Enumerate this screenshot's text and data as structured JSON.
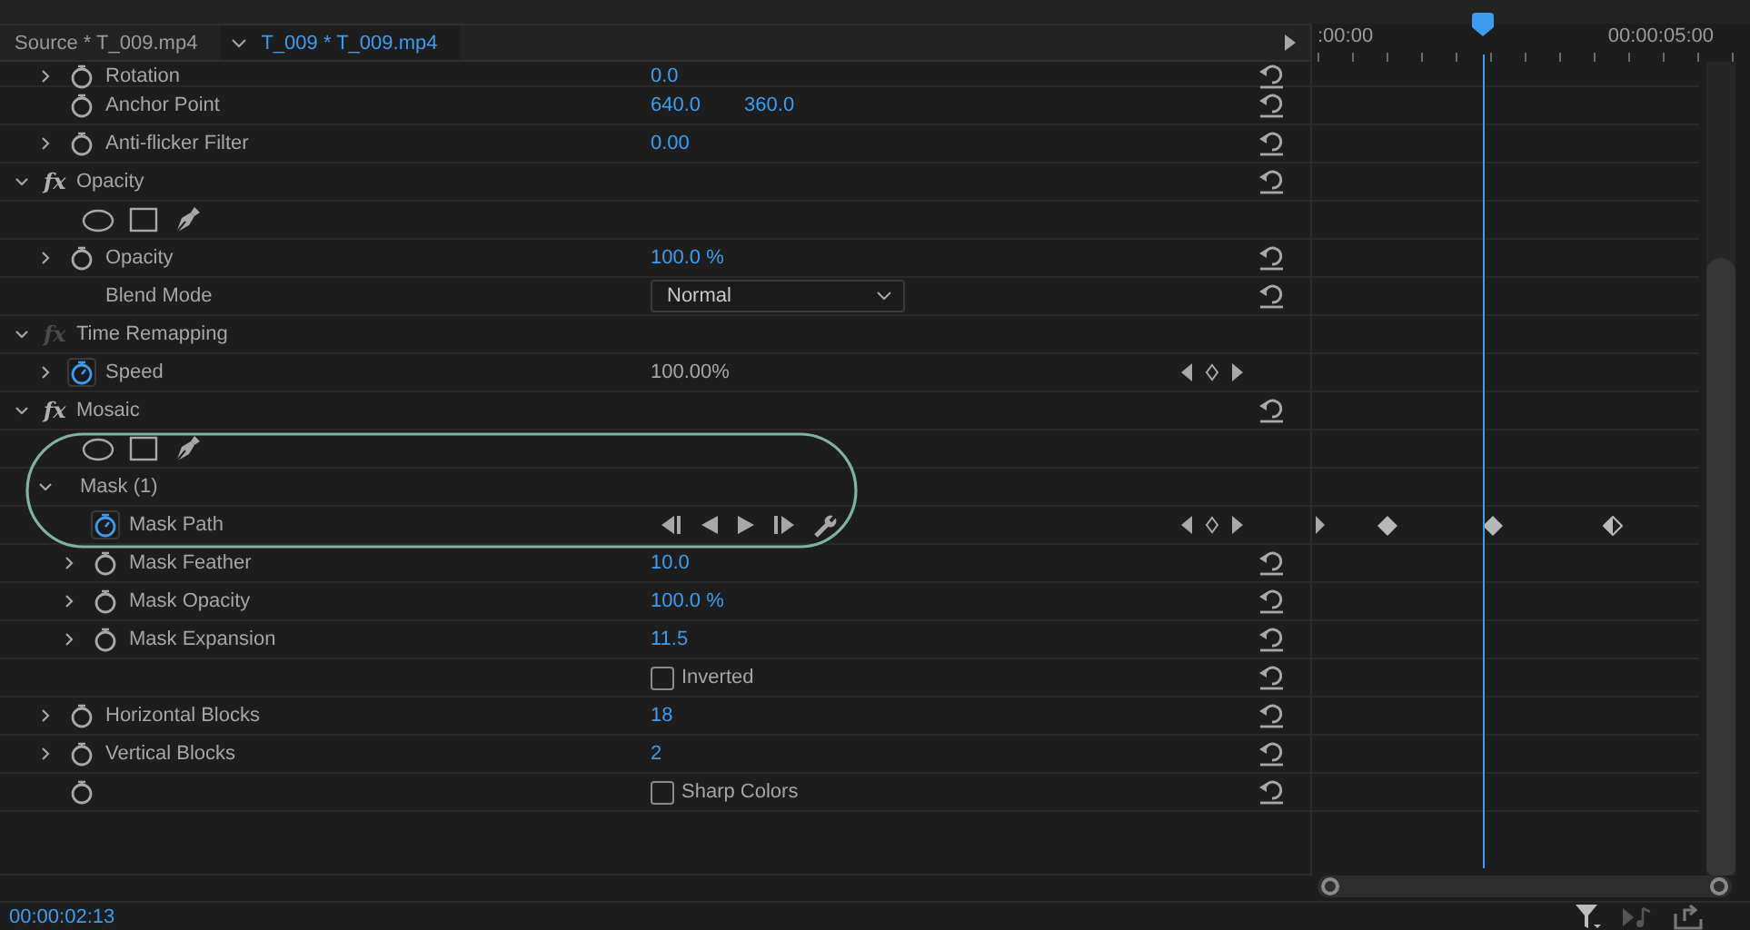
{
  "tabs": [
    {
      "label": "Source * T_009.mp4",
      "selected": false
    },
    {
      "label": "T_009 * T_009.mp4",
      "selected": true
    }
  ],
  "ruler": {
    "start": ":00:00",
    "end": "00:00:05:00"
  },
  "rows": [
    {
      "kind": "property",
      "label": "Rotation",
      "expanded": false,
      "animated": false,
      "values": [
        "0.0"
      ],
      "reset": true
    },
    {
      "kind": "property",
      "label": "Anchor Point",
      "animated": false,
      "values": [
        "640.0",
        "360.0"
      ],
      "reset": true
    },
    {
      "kind": "property",
      "label": "Anti-flicker Filter",
      "expanded": false,
      "animated": false,
      "values": [
        "0.00"
      ],
      "reset": true
    },
    {
      "kind": "effect",
      "label": "Opacity",
      "fx": "fx",
      "fx_enabled": true,
      "expanded": true,
      "reset": true,
      "children": [
        {
          "kind": "mask-tools"
        },
        {
          "kind": "property",
          "label": "Opacity",
          "expanded": false,
          "animated": false,
          "values": [
            "100.0 %"
          ],
          "reset": true
        },
        {
          "kind": "dropdown",
          "label": "Blend Mode",
          "value": "Normal",
          "reset": true
        }
      ]
    },
    {
      "kind": "effect",
      "label": "Time Remapping",
      "fx": "fx",
      "fx_enabled": false,
      "expanded": true,
      "reset": false,
      "children": [
        {
          "kind": "property",
          "label": "Speed",
          "expanded": false,
          "animated": true,
          "values": [
            "100.00%"
          ],
          "editable": false,
          "reset": false,
          "keyframe_nav": true
        }
      ]
    },
    {
      "kind": "effect",
      "label": "Mosaic",
      "fx": "fx",
      "fx_enabled": true,
      "expanded": true,
      "reset": true,
      "children": [
        {
          "kind": "mask-tools"
        },
        {
          "kind": "mask",
          "label": "Mask (1)",
          "expanded": true,
          "children": [
            {
              "kind": "mask-path",
              "label": "Mask Path",
              "animated": true,
              "keyframe_nav": true,
              "keyframes": [
                {
                  "kind": "edge"
                },
                {
                  "kind": "diamond"
                },
                {
                  "kind": "diamond"
                },
                {
                  "kind": "half"
                }
              ]
            },
            {
              "kind": "property",
              "label": "Mask Feather",
              "expanded": false,
              "animated": false,
              "values": [
                "10.0"
              ],
              "reset": true
            },
            {
              "kind": "property",
              "label": "Mask Opacity",
              "expanded": false,
              "animated": false,
              "values": [
                "100.0 %"
              ],
              "reset": true
            },
            {
              "kind": "property",
              "label": "Mask Expansion",
              "expanded": false,
              "animated": false,
              "values": [
                "11.5"
              ],
              "reset": true
            },
            {
              "kind": "checkbox",
              "label": "Inverted",
              "checked": false,
              "reset": true
            }
          ]
        },
        {
          "kind": "property",
          "label": "Horizontal Blocks",
          "expanded": false,
          "animated": false,
          "values": [
            "18"
          ],
          "reset": true
        },
        {
          "kind": "property",
          "label": "Vertical Blocks",
          "expanded": false,
          "animated": false,
          "values": [
            "2"
          ],
          "reset": true
        },
        {
          "kind": "checkbox",
          "label": "Sharp Colors",
          "checked": false,
          "animated": false,
          "reset": true
        }
      ]
    }
  ],
  "timecode": "00:00:02:13"
}
